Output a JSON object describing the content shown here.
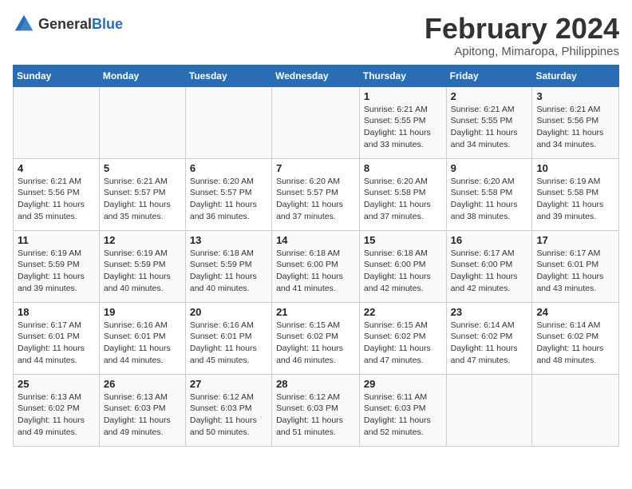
{
  "header": {
    "logo_general": "General",
    "logo_blue": "Blue",
    "month_title": "February 2024",
    "location": "Apitong, Mimaropa, Philippines"
  },
  "days_of_week": [
    "Sunday",
    "Monday",
    "Tuesday",
    "Wednesday",
    "Thursday",
    "Friday",
    "Saturday"
  ],
  "weeks": [
    [
      {
        "day": "",
        "info": ""
      },
      {
        "day": "",
        "info": ""
      },
      {
        "day": "",
        "info": ""
      },
      {
        "day": "",
        "info": ""
      },
      {
        "day": "1",
        "info": "Sunrise: 6:21 AM\nSunset: 5:55 PM\nDaylight: 11 hours and 33 minutes."
      },
      {
        "day": "2",
        "info": "Sunrise: 6:21 AM\nSunset: 5:55 PM\nDaylight: 11 hours and 34 minutes."
      },
      {
        "day": "3",
        "info": "Sunrise: 6:21 AM\nSunset: 5:56 PM\nDaylight: 11 hours and 34 minutes."
      }
    ],
    [
      {
        "day": "4",
        "info": "Sunrise: 6:21 AM\nSunset: 5:56 PM\nDaylight: 11 hours and 35 minutes."
      },
      {
        "day": "5",
        "info": "Sunrise: 6:21 AM\nSunset: 5:57 PM\nDaylight: 11 hours and 35 minutes."
      },
      {
        "day": "6",
        "info": "Sunrise: 6:20 AM\nSunset: 5:57 PM\nDaylight: 11 hours and 36 minutes."
      },
      {
        "day": "7",
        "info": "Sunrise: 6:20 AM\nSunset: 5:57 PM\nDaylight: 11 hours and 37 minutes."
      },
      {
        "day": "8",
        "info": "Sunrise: 6:20 AM\nSunset: 5:58 PM\nDaylight: 11 hours and 37 minutes."
      },
      {
        "day": "9",
        "info": "Sunrise: 6:20 AM\nSunset: 5:58 PM\nDaylight: 11 hours and 38 minutes."
      },
      {
        "day": "10",
        "info": "Sunrise: 6:19 AM\nSunset: 5:58 PM\nDaylight: 11 hours and 39 minutes."
      }
    ],
    [
      {
        "day": "11",
        "info": "Sunrise: 6:19 AM\nSunset: 5:59 PM\nDaylight: 11 hours and 39 minutes."
      },
      {
        "day": "12",
        "info": "Sunrise: 6:19 AM\nSunset: 5:59 PM\nDaylight: 11 hours and 40 minutes."
      },
      {
        "day": "13",
        "info": "Sunrise: 6:18 AM\nSunset: 5:59 PM\nDaylight: 11 hours and 40 minutes."
      },
      {
        "day": "14",
        "info": "Sunrise: 6:18 AM\nSunset: 6:00 PM\nDaylight: 11 hours and 41 minutes."
      },
      {
        "day": "15",
        "info": "Sunrise: 6:18 AM\nSunset: 6:00 PM\nDaylight: 11 hours and 42 minutes."
      },
      {
        "day": "16",
        "info": "Sunrise: 6:17 AM\nSunset: 6:00 PM\nDaylight: 11 hours and 42 minutes."
      },
      {
        "day": "17",
        "info": "Sunrise: 6:17 AM\nSunset: 6:01 PM\nDaylight: 11 hours and 43 minutes."
      }
    ],
    [
      {
        "day": "18",
        "info": "Sunrise: 6:17 AM\nSunset: 6:01 PM\nDaylight: 11 hours and 44 minutes."
      },
      {
        "day": "19",
        "info": "Sunrise: 6:16 AM\nSunset: 6:01 PM\nDaylight: 11 hours and 44 minutes."
      },
      {
        "day": "20",
        "info": "Sunrise: 6:16 AM\nSunset: 6:01 PM\nDaylight: 11 hours and 45 minutes."
      },
      {
        "day": "21",
        "info": "Sunrise: 6:15 AM\nSunset: 6:02 PM\nDaylight: 11 hours and 46 minutes."
      },
      {
        "day": "22",
        "info": "Sunrise: 6:15 AM\nSunset: 6:02 PM\nDaylight: 11 hours and 47 minutes."
      },
      {
        "day": "23",
        "info": "Sunrise: 6:14 AM\nSunset: 6:02 PM\nDaylight: 11 hours and 47 minutes."
      },
      {
        "day": "24",
        "info": "Sunrise: 6:14 AM\nSunset: 6:02 PM\nDaylight: 11 hours and 48 minutes."
      }
    ],
    [
      {
        "day": "25",
        "info": "Sunrise: 6:13 AM\nSunset: 6:02 PM\nDaylight: 11 hours and 49 minutes."
      },
      {
        "day": "26",
        "info": "Sunrise: 6:13 AM\nSunset: 6:03 PM\nDaylight: 11 hours and 49 minutes."
      },
      {
        "day": "27",
        "info": "Sunrise: 6:12 AM\nSunset: 6:03 PM\nDaylight: 11 hours and 50 minutes."
      },
      {
        "day": "28",
        "info": "Sunrise: 6:12 AM\nSunset: 6:03 PM\nDaylight: 11 hours and 51 minutes."
      },
      {
        "day": "29",
        "info": "Sunrise: 6:11 AM\nSunset: 6:03 PM\nDaylight: 11 hours and 52 minutes."
      },
      {
        "day": "",
        "info": ""
      },
      {
        "day": "",
        "info": ""
      }
    ]
  ]
}
